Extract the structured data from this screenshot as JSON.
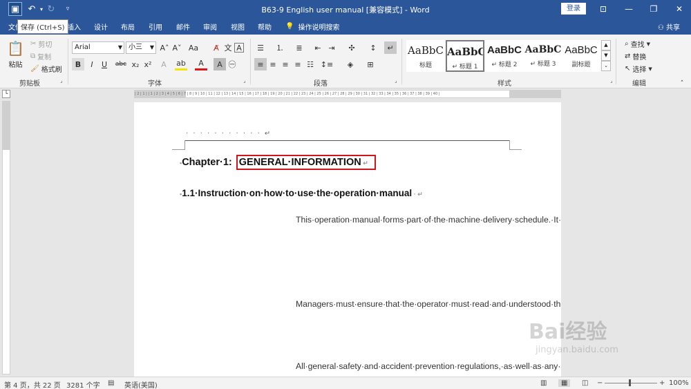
{
  "window": {
    "title": "B63-9 English user manual [兼容模式] - Word",
    "login": "登录",
    "tooltip": "保存 (Ctrl+S)"
  },
  "tabs": [
    "文件",
    "插入",
    "设计",
    "布局",
    "引用",
    "邮件",
    "审阅",
    "视图",
    "帮助"
  ],
  "tell_me": "操作说明搜索",
  "share": "共享",
  "clipboard": {
    "paste": "粘贴",
    "cut": "剪切",
    "copy": "复制",
    "format_painter": "格式刷",
    "label": "剪贴板"
  },
  "font": {
    "name": "Arial",
    "size": "小三",
    "label": "字体"
  },
  "paragraph": {
    "label": "段落"
  },
  "styles": {
    "items": [
      {
        "sample": "AaBbC",
        "name": "标题"
      },
      {
        "sample": "AaBbC",
        "name": "↵ 标题 1"
      },
      {
        "sample": "AaBbC",
        "name": "↵ 标题 2"
      },
      {
        "sample": "AaBbC",
        "name": "↵ 标题 3"
      },
      {
        "sample": "AaBbC",
        "name": "副标题"
      }
    ],
    "label": "样式"
  },
  "editing": {
    "find": "查找",
    "replace": "替换",
    "select": "选择",
    "label": "编辑"
  },
  "ruler": {
    "ticks": "| 2 | 1 | | 1 | 2 | 3 | 4 | 5 | 6 | 7 | 8 | 9 | 10 | 11 | 12 | 13 | 14 | 15 | 16 | 17 | 18 | 19 | 20 | 21 | 22 | 23 | 24 | 25 | 26 | 27 | 28 | 29 | 30 | 31 | 32 | 33 | 34 | 35 | 36 | 37 | 38 | 39 | 40 |"
  },
  "document": {
    "header_dots": "· · · · · · · · · · · ↵",
    "chapter_prefix": "Chapter·1:",
    "chapter_highlight": "GENERAL·INFORMATION",
    "section": "1.1·Instruction·on·how·to·use·the·operation·manual",
    "paragraphs": [
      "This·operation·manual·forms·part·of·the·machine·delivery·schedule.·It·contains·important·instructions·on·how·to·operate·the·machine·safely,·properly·and·economically.·Compliance·with·its·instructions·will·help·to·avoid·possible·danger,·reduce·repair·work·and·stoppage·times,·and·increase·the·reliability·and·serviceable·life·of·the·machine.",
      "Managers·must·ensure·that·the·operator·must·read·and·understood·the·operation·manual.·The·operating·manual·must·be·kept·within·easy·reach·at·the·machine·site.·Should·the·machine·be·transferred·to·new·ownership,·the·operating·manual·must·accompany·it.",
      "All·general·safety·and·accident·prevention·regulations,·as·well·as·any·safety·recommendations·made·by·the"
    ]
  },
  "status": {
    "page": "第 4 页，共 22 页",
    "words": "3281 个字",
    "language": "英语(美国)",
    "zoom": "100%"
  },
  "watermark": {
    "brand": "Bai经验",
    "domain": "jingyan.baidu.com"
  }
}
